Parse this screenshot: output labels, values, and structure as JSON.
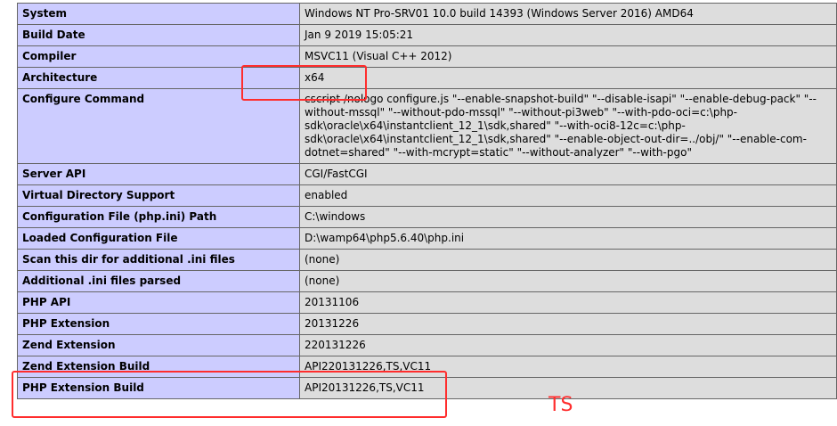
{
  "rows": [
    {
      "key": "System",
      "value": "Windows NT Pro-SRV01 10.0 build 14393 (Windows Server 2016) AMD64"
    },
    {
      "key": "Build Date",
      "value": "Jan 9 2019 15:05:21"
    },
    {
      "key": "Compiler",
      "value": "MSVC11 (Visual C++ 2012)"
    },
    {
      "key": "Architecture",
      "value": "x64"
    },
    {
      "key": "Configure Command",
      "value": "cscript /nologo configure.js \"--enable-snapshot-build\" \"--disable-isapi\" \"--enable-debug-pack\" \"--without-mssql\" \"--without-pdo-mssql\" \"--without-pi3web\" \"--with-pdo-oci=c:\\php-sdk\\oracle\\x64\\instantclient_12_1\\sdk,shared\" \"--with-oci8-12c=c:\\php-sdk\\oracle\\x64\\instantclient_12_1\\sdk,shared\" \"--enable-object-out-dir=../obj/\" \"--enable-com-dotnet=shared\" \"--with-mcrypt=static\" \"--without-analyzer\" \"--with-pgo\""
    },
    {
      "key": "Server API",
      "value": "CGI/FastCGI"
    },
    {
      "key": "Virtual Directory Support",
      "value": "enabled"
    },
    {
      "key": "Configuration File (php.ini) Path",
      "value": "C:\\windows"
    },
    {
      "key": "Loaded Configuration File",
      "value": "D:\\wamp64\\php5.6.40\\php.ini"
    },
    {
      "key": "Scan this dir for additional .ini files",
      "value": "(none)"
    },
    {
      "key": "Additional .ini files parsed",
      "value": "(none)"
    },
    {
      "key": "PHP API",
      "value": "20131106"
    },
    {
      "key": "PHP Extension",
      "value": "20131226"
    },
    {
      "key": "Zend Extension",
      "value": "220131226"
    },
    {
      "key": "Zend Extension Build",
      "value": "API220131226,TS,VC11"
    },
    {
      "key": "PHP Extension Build",
      "value": "API20131226,TS,VC11"
    }
  ],
  "annotation": {
    "label": "TS",
    "color": "#ff2d2d"
  }
}
